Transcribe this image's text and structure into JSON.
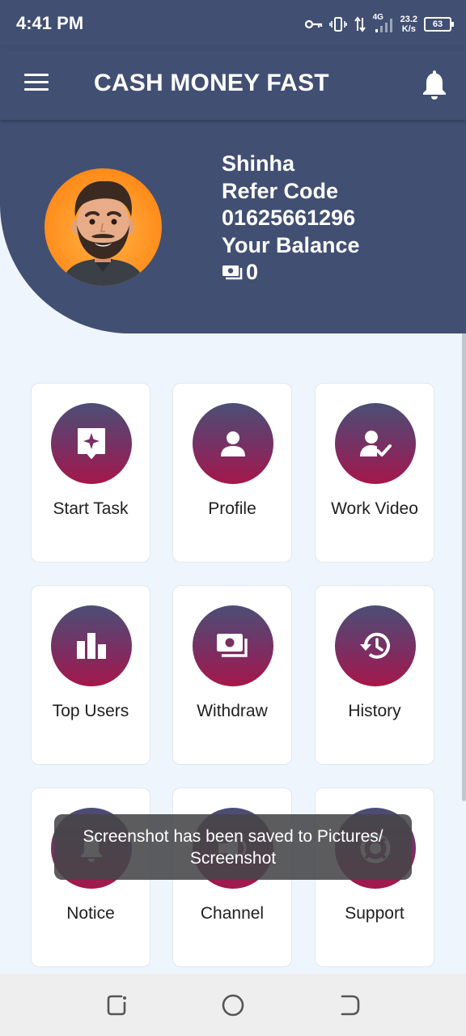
{
  "status_bar": {
    "time": "4:41 PM",
    "network_type": "4G",
    "net_speed_value": "23.2",
    "net_speed_unit": "K/s",
    "battery_level": "63",
    "icons": [
      "key-icon",
      "vibrate-icon",
      "data-arrows-icon",
      "signal-icon",
      "battery-icon"
    ]
  },
  "app_bar": {
    "title": "CASH MONEY FAST",
    "menu_icon": "menu-icon",
    "bell_icon": "bell-icon"
  },
  "profile": {
    "name": "Shinha",
    "refer_code_label": "Refer Code",
    "refer_code": "01625661296",
    "balance_label": "Your Balance",
    "balance_value": "0",
    "balance_icon": "money-icon"
  },
  "menu_tiles": [
    {
      "label": "Start Task",
      "icon": "sparkle-chat-icon"
    },
    {
      "label": "Profile",
      "icon": "person-icon"
    },
    {
      "label": "Work Video",
      "icon": "person-check-icon"
    },
    {
      "label": "Top Users",
      "icon": "bar-chart-icon"
    },
    {
      "label": "Withdraw",
      "icon": "money-icon"
    },
    {
      "label": "History",
      "icon": "history-icon"
    },
    {
      "label": "Notice",
      "icon": "bell-icon"
    },
    {
      "label": "Channel",
      "icon": "channel-icon"
    },
    {
      "label": "Support",
      "icon": "support-icon"
    }
  ],
  "toast": {
    "message": "Screenshot has been saved to  Pictures/ Screenshot"
  },
  "nav_bar": {
    "items": [
      "recents-icon",
      "home-icon",
      "back-icon"
    ]
  },
  "colors": {
    "header_bg": "#414f73",
    "page_bg": "#eef5fd",
    "icon_gradient_top": "#4a4f75",
    "icon_gradient_bottom": "#a5174a"
  }
}
